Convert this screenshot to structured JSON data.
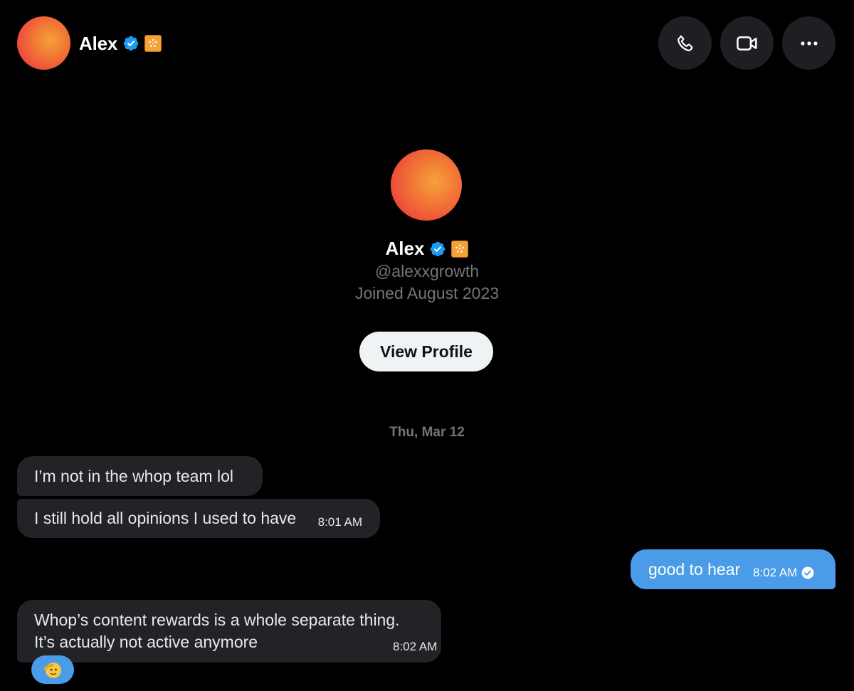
{
  "header": {
    "name": "Alex",
    "verified_icon": "verified-badge-icon",
    "affiliate_icon": "affiliate-badge-icon",
    "actions": [
      {
        "name": "call-button",
        "icon": "phone-icon"
      },
      {
        "name": "video-call-button",
        "icon": "video-camera-icon"
      },
      {
        "name": "more-options-button",
        "icon": "more-horizontal-icon"
      }
    ]
  },
  "profile": {
    "name": "Alex",
    "handle": "@alexxgrowth",
    "joined": "Joined August 2023",
    "view_profile_label": "View Profile"
  },
  "conversation": {
    "date_separator": "Thu, Mar 12",
    "messages": [
      {
        "from": "them",
        "text": "I’m not in the whop team lol"
      },
      {
        "from": "them",
        "text": "I still hold all opinions I used to have",
        "time": "8:01 AM"
      },
      {
        "from": "me",
        "text": "good to hear",
        "time": "8:02 AM",
        "status_icon": "sent-check-icon"
      },
      {
        "from": "them",
        "lines": [
          "Whop’s content rewards is a whole separate thing.",
          "It’s actually not active anymore"
        ],
        "time": "8:02 AM",
        "reaction": "saluting-face-emoji"
      }
    ]
  },
  "colors": {
    "background": "#000000",
    "received_bubble": "#212327",
    "sent_bubble": "#4a9ce8",
    "muted_text": "#71767b",
    "verified_blue": "#1d9bf0",
    "affiliate_badge": "#f2a23a"
  }
}
